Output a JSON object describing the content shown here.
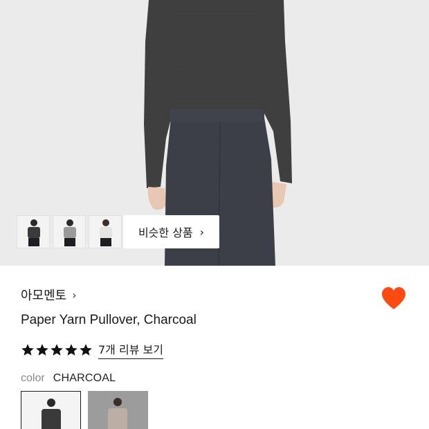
{
  "gallery": {
    "thumbnails": [
      {
        "name": "thumb-charcoal",
        "color": "#3a3a3a"
      },
      {
        "name": "thumb-grey",
        "color": "#9a9a9a"
      },
      {
        "name": "thumb-ivory",
        "color": "#e6e6e2"
      }
    ],
    "similar_button_label": "비슷한 상품",
    "similar_button_chevron": "›"
  },
  "product": {
    "brand": "아모멘토",
    "brand_chevron": "›",
    "title": "Paper Yarn Pullover, Charcoal",
    "rating_stars": 5,
    "review_link": "7개 리뷰 보기",
    "wishlisted": true,
    "heart_color": "#ff4a12",
    "color_label": "color",
    "color_value": "CHARCOAL",
    "swatches": [
      {
        "name": "swatch-charcoal",
        "color": "#3a3a3a",
        "selected": true
      },
      {
        "name": "swatch-beige",
        "color": "#bcaea4",
        "selected": false
      }
    ]
  }
}
